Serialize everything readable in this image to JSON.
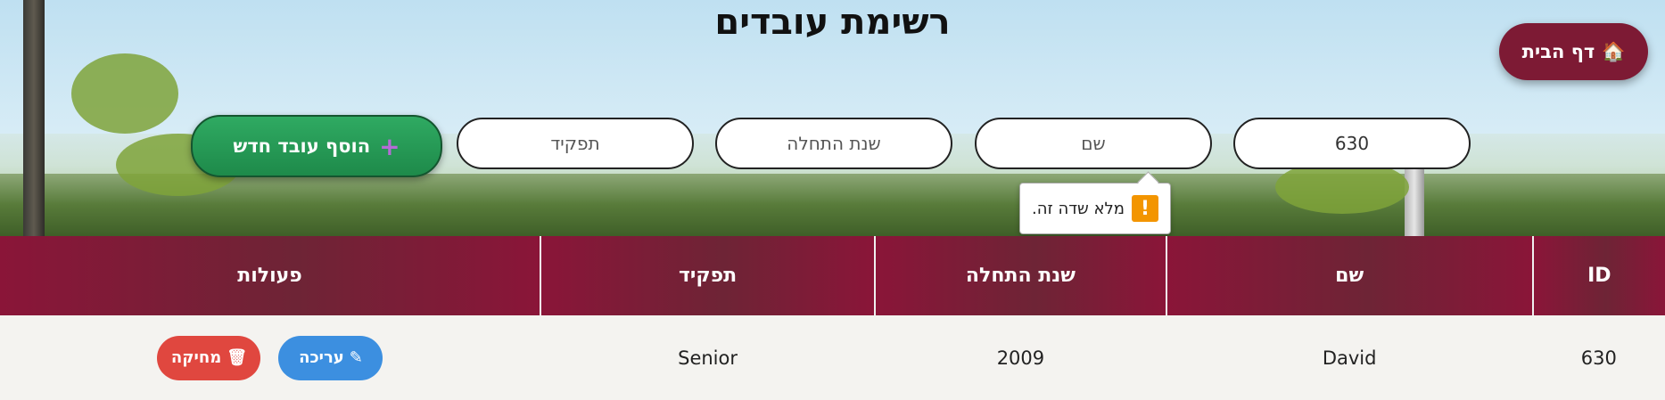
{
  "header": {
    "title": "רשימת עובדים",
    "home_button": {
      "icon": "🏠",
      "label": "דף הבית"
    }
  },
  "form": {
    "id_value": "630",
    "name_placeholder": "שם",
    "start_year_placeholder": "שנת התחלה",
    "role_placeholder": "תפקיד",
    "add_button": {
      "icon": "+",
      "label": "הוסף עובד חדש"
    },
    "validation_tooltip": {
      "icon": "!",
      "text": "מלא שדה זה."
    }
  },
  "table": {
    "headers": [
      "ID",
      "שם",
      "שנת התחלה",
      "תפקיד",
      "פעולות"
    ],
    "rows": [
      {
        "id": "630",
        "name": "David",
        "start_year": "2009",
        "role": "Senior"
      }
    ],
    "edit_button": {
      "icon": "✎",
      "label": "עריכה"
    },
    "delete_button": {
      "icon": "🗑",
      "label": "מחיקה"
    }
  },
  "colors": {
    "header_bg": "#8a1538",
    "home_button": "#7d1a34",
    "add_button": "#2faa62",
    "edit_button": "#3c8fe0",
    "delete_button": "#e0473f",
    "warning": "#f39500"
  }
}
